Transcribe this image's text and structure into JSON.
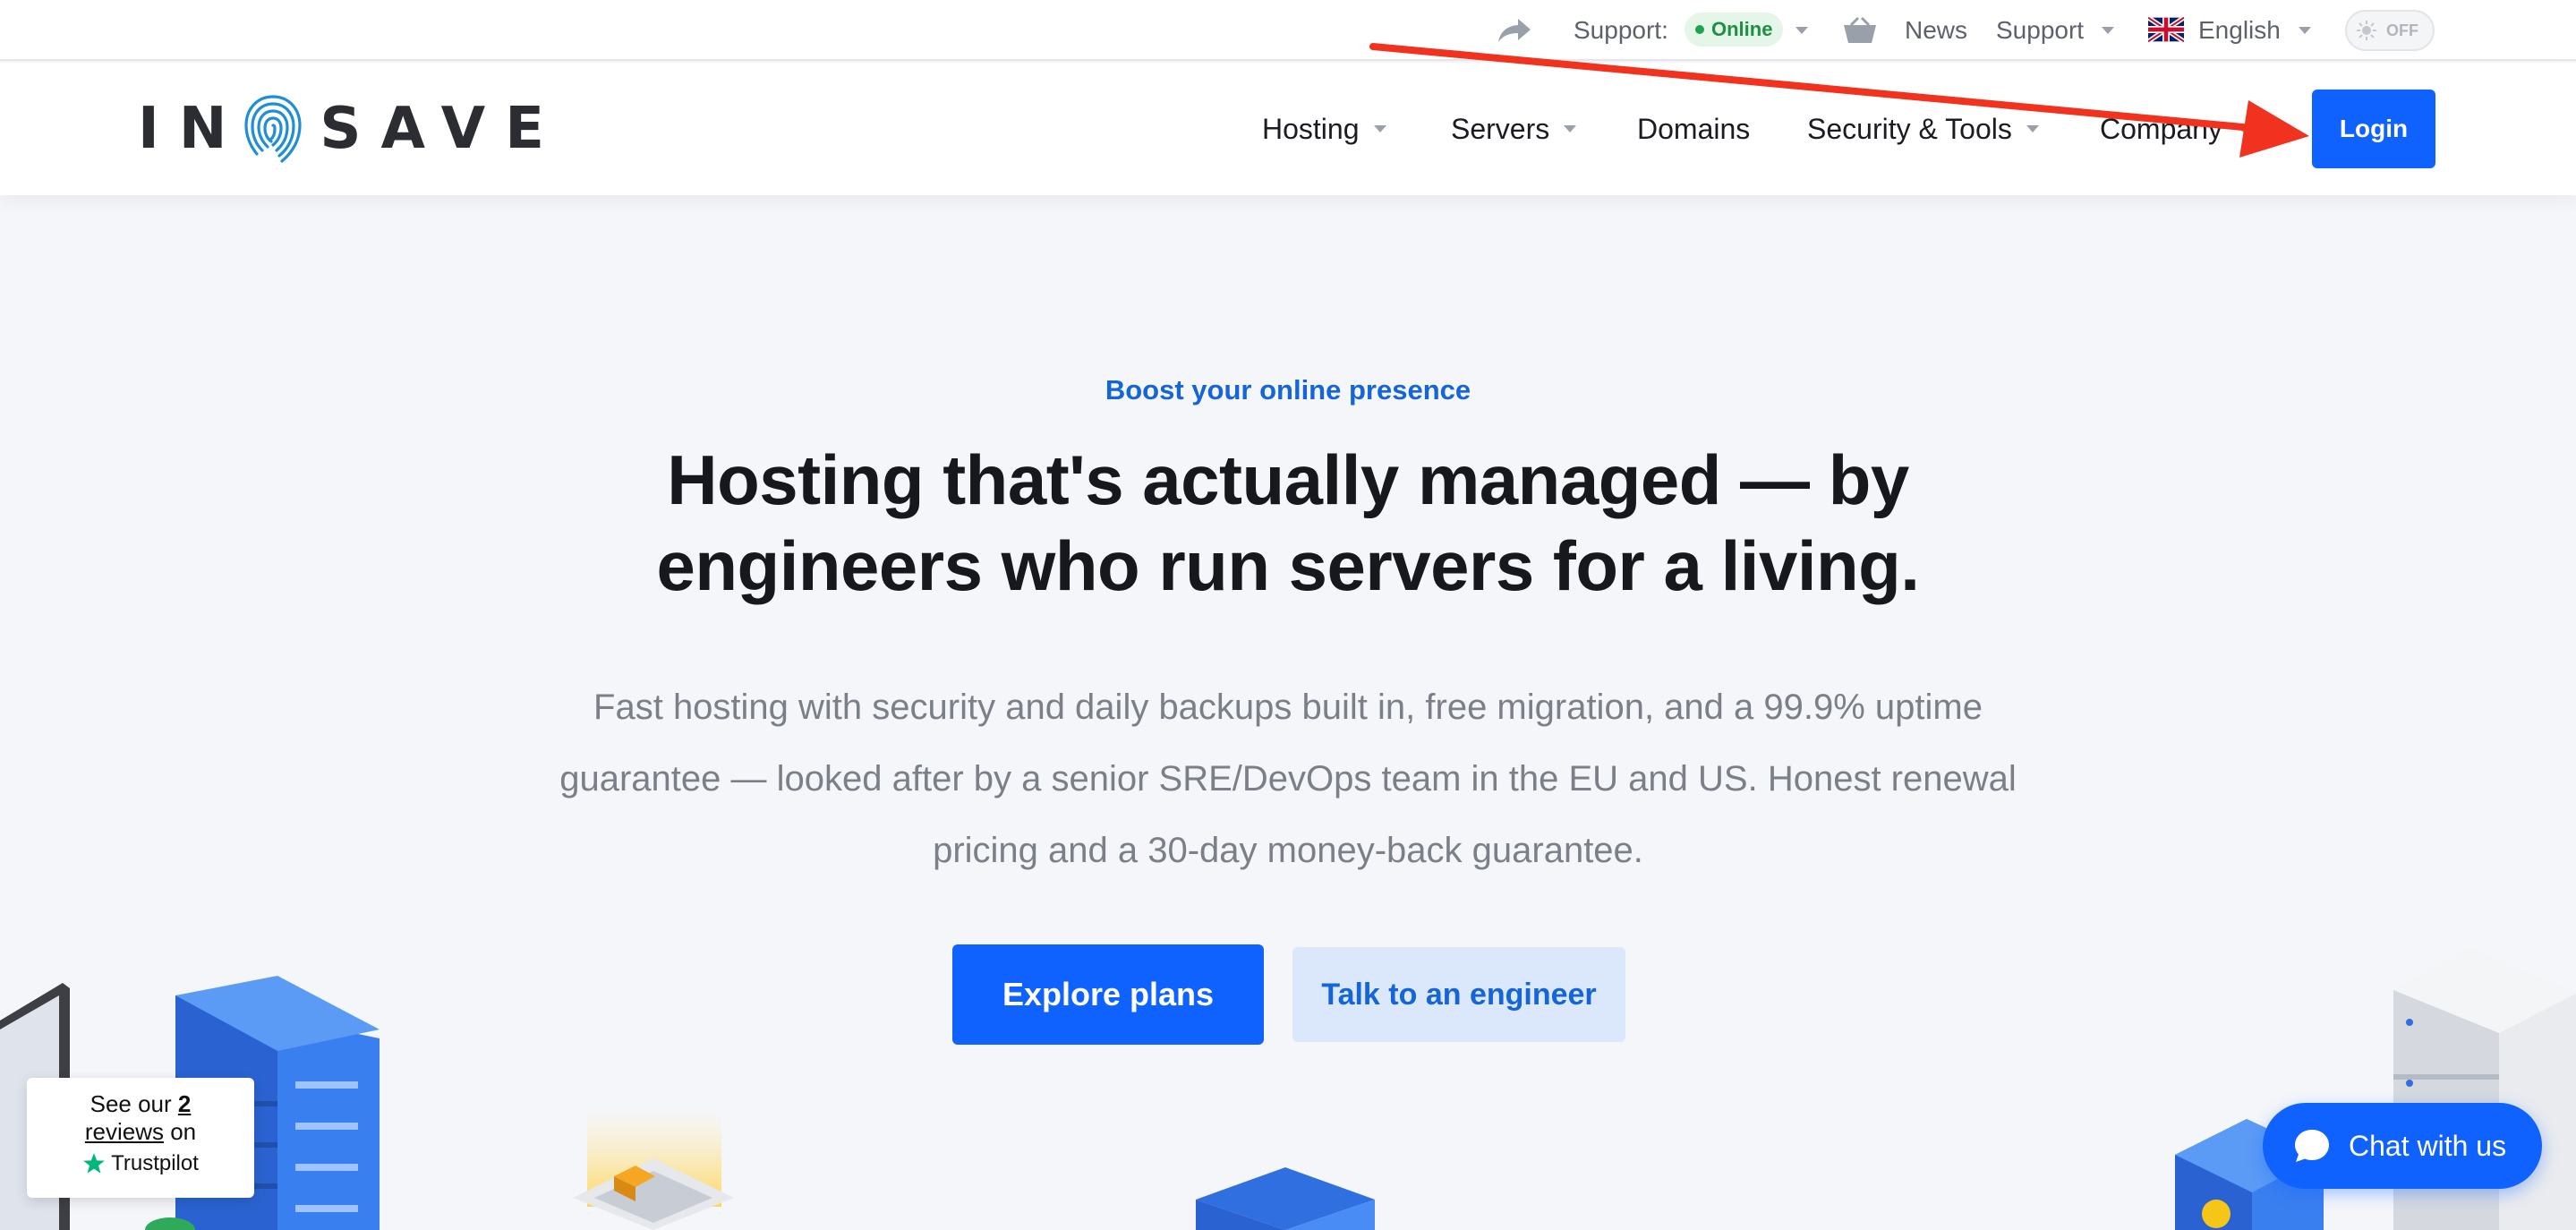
{
  "topbar": {
    "support_label": "Support:",
    "status_badge": "Online",
    "news": "News",
    "support": "Support",
    "language": "English",
    "theme_toggle": "OFF"
  },
  "nav": {
    "logo_left": "IN",
    "logo_right": "SAVE",
    "items": [
      "Hosting",
      "Servers",
      "Domains",
      "Security & Tools",
      "Company"
    ],
    "login": "Login"
  },
  "hero": {
    "eyebrow": "Boost your online presence",
    "title": "Hosting that's actually managed — by engineers who run servers for a living.",
    "subtitle": "Fast hosting with security and daily backups built in, free migration, and a 99.9% uptime guarantee — looked after by a senior SRE/DevOps team in the EU and US. Honest renewal pricing and a 30-day money-back guarantee.",
    "primary_cta": "Explore plans",
    "secondary_cta": "Talk to an engineer"
  },
  "trustpilot": {
    "prefix": "See our ",
    "count": "2",
    "reviews": "reviews",
    "suffix": " on",
    "brand": "Trustpilot"
  },
  "chat": {
    "label": "Chat with us"
  },
  "colors": {
    "primary": "#0f62fe",
    "secondary_bg": "#dbe7fb",
    "online": "#22a24c",
    "annotation": "#f0321e",
    "trustpilot_star": "#00b67a"
  }
}
